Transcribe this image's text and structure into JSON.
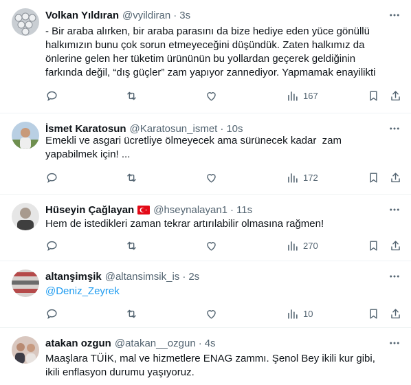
{
  "tweets": [
    {
      "name": "Volkan Yıldıran",
      "handle": "@vyildiran",
      "time": "3s",
      "text": "- Bir araba alırken, bir araba parasını da bize hediye eden yüce gönüllü halkımızın bunu çok sorun etmeyeceğini düşündük. Zaten halkımız da önlerine gelen her tüketim ürününün bu yollardan geçerek geldiğinin farkında değil, “dış güçler” zam yapıyor zannediyor. Yapmamak enayilikti",
      "views": "167"
    },
    {
      "name": "İsmet Karatosun",
      "handle": "@Karatosun_ismet",
      "time": "10s",
      "text": "Emekli ve asgari ücretliye ölmeyecek ama sürünecek kadar  zam yapabilmek için! ...",
      "views": "172"
    },
    {
      "name": "Hüseyin Çağlayan",
      "handle": "@hseynalayan1",
      "time": "11s",
      "text": "Hem de istedikleri zaman tekrar artırılabilir olmasına rağmen!",
      "views": "270",
      "flag": "turkey-flag"
    },
    {
      "name": "altanşimşik",
      "handle": "@altansimsik_is",
      "time": "2s",
      "text": "@Deniz_Zeyrek",
      "views": "10"
    },
    {
      "name": "atakan ozgun",
      "handle": "@atakan__ozgun",
      "time": "4s",
      "text": "Maaşlara TÜİK, mal ve hizmetlere ENAG zammı. Şenol Bey ikili kur gibi, ikili enflasyon durumu yaşıyoruz."
    }
  ],
  "colors": {
    "text": "#0f1419",
    "muted": "#536471",
    "link": "#1d9bf0",
    "divider": "#eff3f4"
  }
}
